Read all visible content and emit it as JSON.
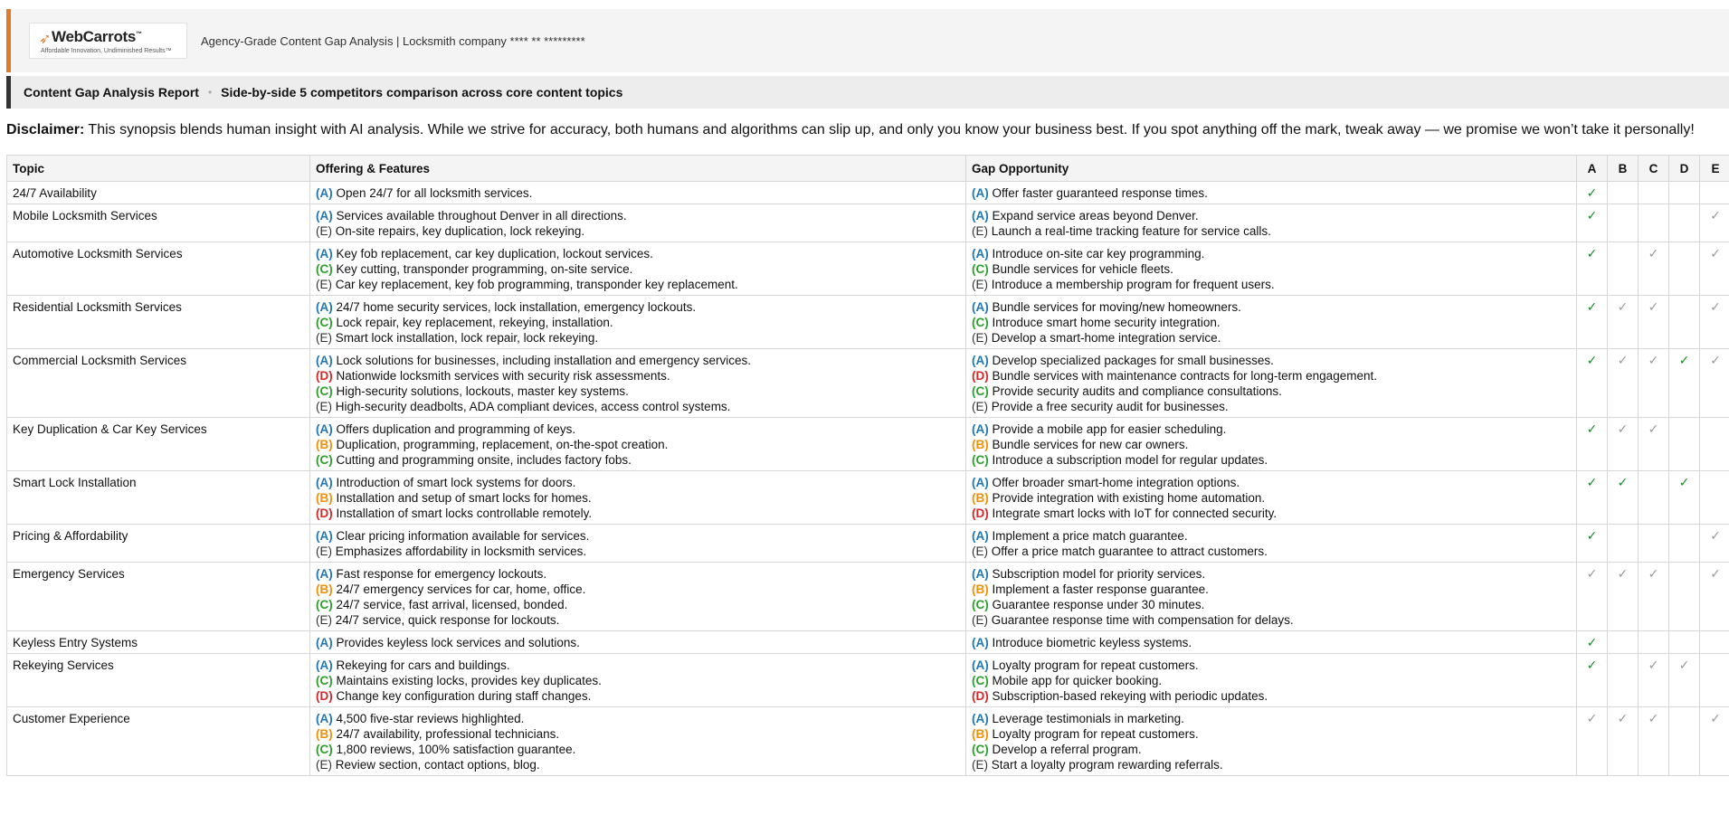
{
  "header": {
    "logo": {
      "name": "WebCarrots",
      "tm": "™",
      "tagline": "Affordable Innovation, Undiminished Results™"
    },
    "title": "Agency-Grade Content Gap Analysis | Locksmith company **** ** *********"
  },
  "subbar": {
    "title": "Content Gap Analysis Report",
    "subtitle": "Side-by-side 5 competitors comparison across core content topics"
  },
  "disclaimer": {
    "label": "Disclaimer:",
    "text": " This synopsis blends human insight with AI analysis. While we strive for accuracy, both humans and algorithms can slip up, and only you know your business best. If you spot anything off the mark, tweak away — we promise we won’t take it personally!"
  },
  "colors": {
    "accent": "#e07b26",
    "A": "#1f77b4",
    "B": "#f0900a",
    "C": "#2ca02c",
    "D": "#d62728",
    "check": "#1a8a2a"
  },
  "table": {
    "headers": [
      "Topic",
      "Offering & Features",
      "Gap Opportunity",
      "A",
      "B",
      "C",
      "D",
      "E"
    ],
    "rows": [
      {
        "topic": "24/7 Availability",
        "offering": [
          [
            "A",
            "Open 24/7 for all locksmith services."
          ]
        ],
        "gap": [
          [
            "A",
            "Offer faster guaranteed response times."
          ]
        ],
        "checks": [
          "strong",
          "",
          "",
          "",
          ""
        ]
      },
      {
        "topic": "Mobile Locksmith Services",
        "offering": [
          [
            "A",
            "Services available throughout Denver in all directions."
          ],
          [
            "E",
            "On-site repairs, key duplication, lock rekeying."
          ]
        ],
        "gap": [
          [
            "A",
            "Expand service areas beyond Denver."
          ],
          [
            "E",
            "Launch a real-time tracking feature for service calls."
          ]
        ],
        "checks": [
          "strong",
          "",
          "",
          "",
          "light"
        ]
      },
      {
        "topic": "Automotive Locksmith Services",
        "offering": [
          [
            "A",
            "Key fob replacement, car key duplication, lockout services."
          ],
          [
            "C",
            "Key cutting, transponder programming, on-site service."
          ],
          [
            "E",
            "Car key replacement, key fob programming, transponder key replacement."
          ]
        ],
        "gap": [
          [
            "A",
            "Introduce on-site car key programming."
          ],
          [
            "C",
            "Bundle services for vehicle fleets."
          ],
          [
            "E",
            "Introduce a membership program for frequent users."
          ]
        ],
        "checks": [
          "strong",
          "",
          "light",
          "",
          "light"
        ]
      },
      {
        "topic": "Residential Locksmith Services",
        "offering": [
          [
            "A",
            "24/7 home security services, lock installation, emergency lockouts."
          ],
          [
            "C",
            "Lock repair, key replacement, rekeying, installation."
          ],
          [
            "E",
            "Smart lock installation, lock repair, lock rekeying."
          ]
        ],
        "gap": [
          [
            "A",
            "Bundle services for moving/new homeowners."
          ],
          [
            "C",
            "Introduce smart home security integration."
          ],
          [
            "E",
            "Develop a smart-home integration service."
          ]
        ],
        "checks": [
          "strong",
          "light",
          "light",
          "",
          "light"
        ]
      },
      {
        "topic": "Commercial Locksmith Services",
        "offering": [
          [
            "A",
            "Lock solutions for businesses, including installation and emergency services."
          ],
          [
            "D",
            "Nationwide locksmith services with security risk assessments."
          ],
          [
            "C",
            "High-security solutions, lockouts, master key systems."
          ],
          [
            "E",
            "High-security deadbolts, ADA compliant devices, access control systems."
          ]
        ],
        "gap": [
          [
            "A",
            "Develop specialized packages for small businesses."
          ],
          [
            "D",
            "Bundle services with maintenance contracts for long-term engagement."
          ],
          [
            "C",
            "Provide security audits and compliance consultations."
          ],
          [
            "E",
            "Provide a free security audit for businesses."
          ]
        ],
        "checks": [
          "strong",
          "light",
          "light",
          "strong",
          "light"
        ]
      },
      {
        "topic": "Key Duplication & Car Key Services",
        "offering": [
          [
            "A",
            "Offers duplication and programming of keys."
          ],
          [
            "B",
            "Duplication, programming, replacement, on-the-spot creation."
          ],
          [
            "C",
            "Cutting and programming onsite, includes factory fobs."
          ]
        ],
        "gap": [
          [
            "A",
            "Provide a mobile app for easier scheduling."
          ],
          [
            "B",
            "Bundle services for new car owners."
          ],
          [
            "C",
            "Introduce a subscription model for regular updates."
          ]
        ],
        "checks": [
          "strong",
          "light",
          "light",
          "",
          ""
        ]
      },
      {
        "topic": "Smart Lock Installation",
        "offering": [
          [
            "A",
            "Introduction of smart lock systems for doors."
          ],
          [
            "B",
            "Installation and setup of smart locks for homes."
          ],
          [
            "D",
            "Installation of smart locks controllable remotely."
          ]
        ],
        "gap": [
          [
            "A",
            "Offer broader smart-home integration options."
          ],
          [
            "B",
            "Provide integration with existing home automation."
          ],
          [
            "D",
            "Integrate smart locks with IoT for connected security."
          ]
        ],
        "checks": [
          "strong",
          "strong",
          "",
          "strong",
          ""
        ]
      },
      {
        "topic": "Pricing & Affordability",
        "offering": [
          [
            "A",
            "Clear pricing information available for services."
          ],
          [
            "E",
            "Emphasizes affordability in locksmith services."
          ]
        ],
        "gap": [
          [
            "A",
            "Implement a price match guarantee."
          ],
          [
            "E",
            "Offer a price match guarantee to attract customers."
          ]
        ],
        "checks": [
          "strong",
          "",
          "",
          "",
          "light"
        ]
      },
      {
        "topic": "Emergency Services",
        "offering": [
          [
            "A",
            "Fast response for emergency lockouts."
          ],
          [
            "B",
            "24/7 emergency services for car, home, office."
          ],
          [
            "C",
            "24/7 service, fast arrival, licensed, bonded."
          ],
          [
            "E",
            "24/7 service, quick response for lockouts."
          ]
        ],
        "gap": [
          [
            "A",
            "Subscription model for priority services."
          ],
          [
            "B",
            "Implement a faster response guarantee."
          ],
          [
            "C",
            "Guarantee response under 30 minutes."
          ],
          [
            "E",
            "Guarantee response time with compensation for delays."
          ]
        ],
        "checks": [
          "light",
          "light",
          "light",
          "",
          "light"
        ]
      },
      {
        "topic": "Keyless Entry Systems",
        "offering": [
          [
            "A",
            "Provides keyless lock services and solutions."
          ]
        ],
        "gap": [
          [
            "A",
            "Introduce biometric keyless systems."
          ]
        ],
        "checks": [
          "strong",
          "",
          "",
          "",
          ""
        ]
      },
      {
        "topic": "Rekeying Services",
        "offering": [
          [
            "A",
            "Rekeying for cars and buildings."
          ],
          [
            "C",
            "Maintains existing locks, provides key duplicates."
          ],
          [
            "D",
            "Change key configuration during staff changes."
          ]
        ],
        "gap": [
          [
            "A",
            "Loyalty program for repeat customers."
          ],
          [
            "C",
            "Mobile app for quicker booking."
          ],
          [
            "D",
            "Subscription-based rekeying with periodic updates."
          ]
        ],
        "checks": [
          "strong",
          "",
          "light",
          "light",
          ""
        ]
      },
      {
        "topic": "Customer Experience",
        "offering": [
          [
            "A",
            "4,500 five-star reviews highlighted."
          ],
          [
            "B",
            "24/7 availability, professional technicians."
          ],
          [
            "C",
            "1,800 reviews, 100% satisfaction guarantee."
          ],
          [
            "E",
            "Review section, contact options, blog."
          ]
        ],
        "gap": [
          [
            "A",
            "Leverage testimonials in marketing."
          ],
          [
            "B",
            "Loyalty program for repeat customers."
          ],
          [
            "C",
            "Develop a referral program."
          ],
          [
            "E",
            "Start a loyalty program rewarding referrals."
          ]
        ],
        "checks": [
          "light",
          "light",
          "light",
          "",
          "light"
        ]
      }
    ]
  }
}
